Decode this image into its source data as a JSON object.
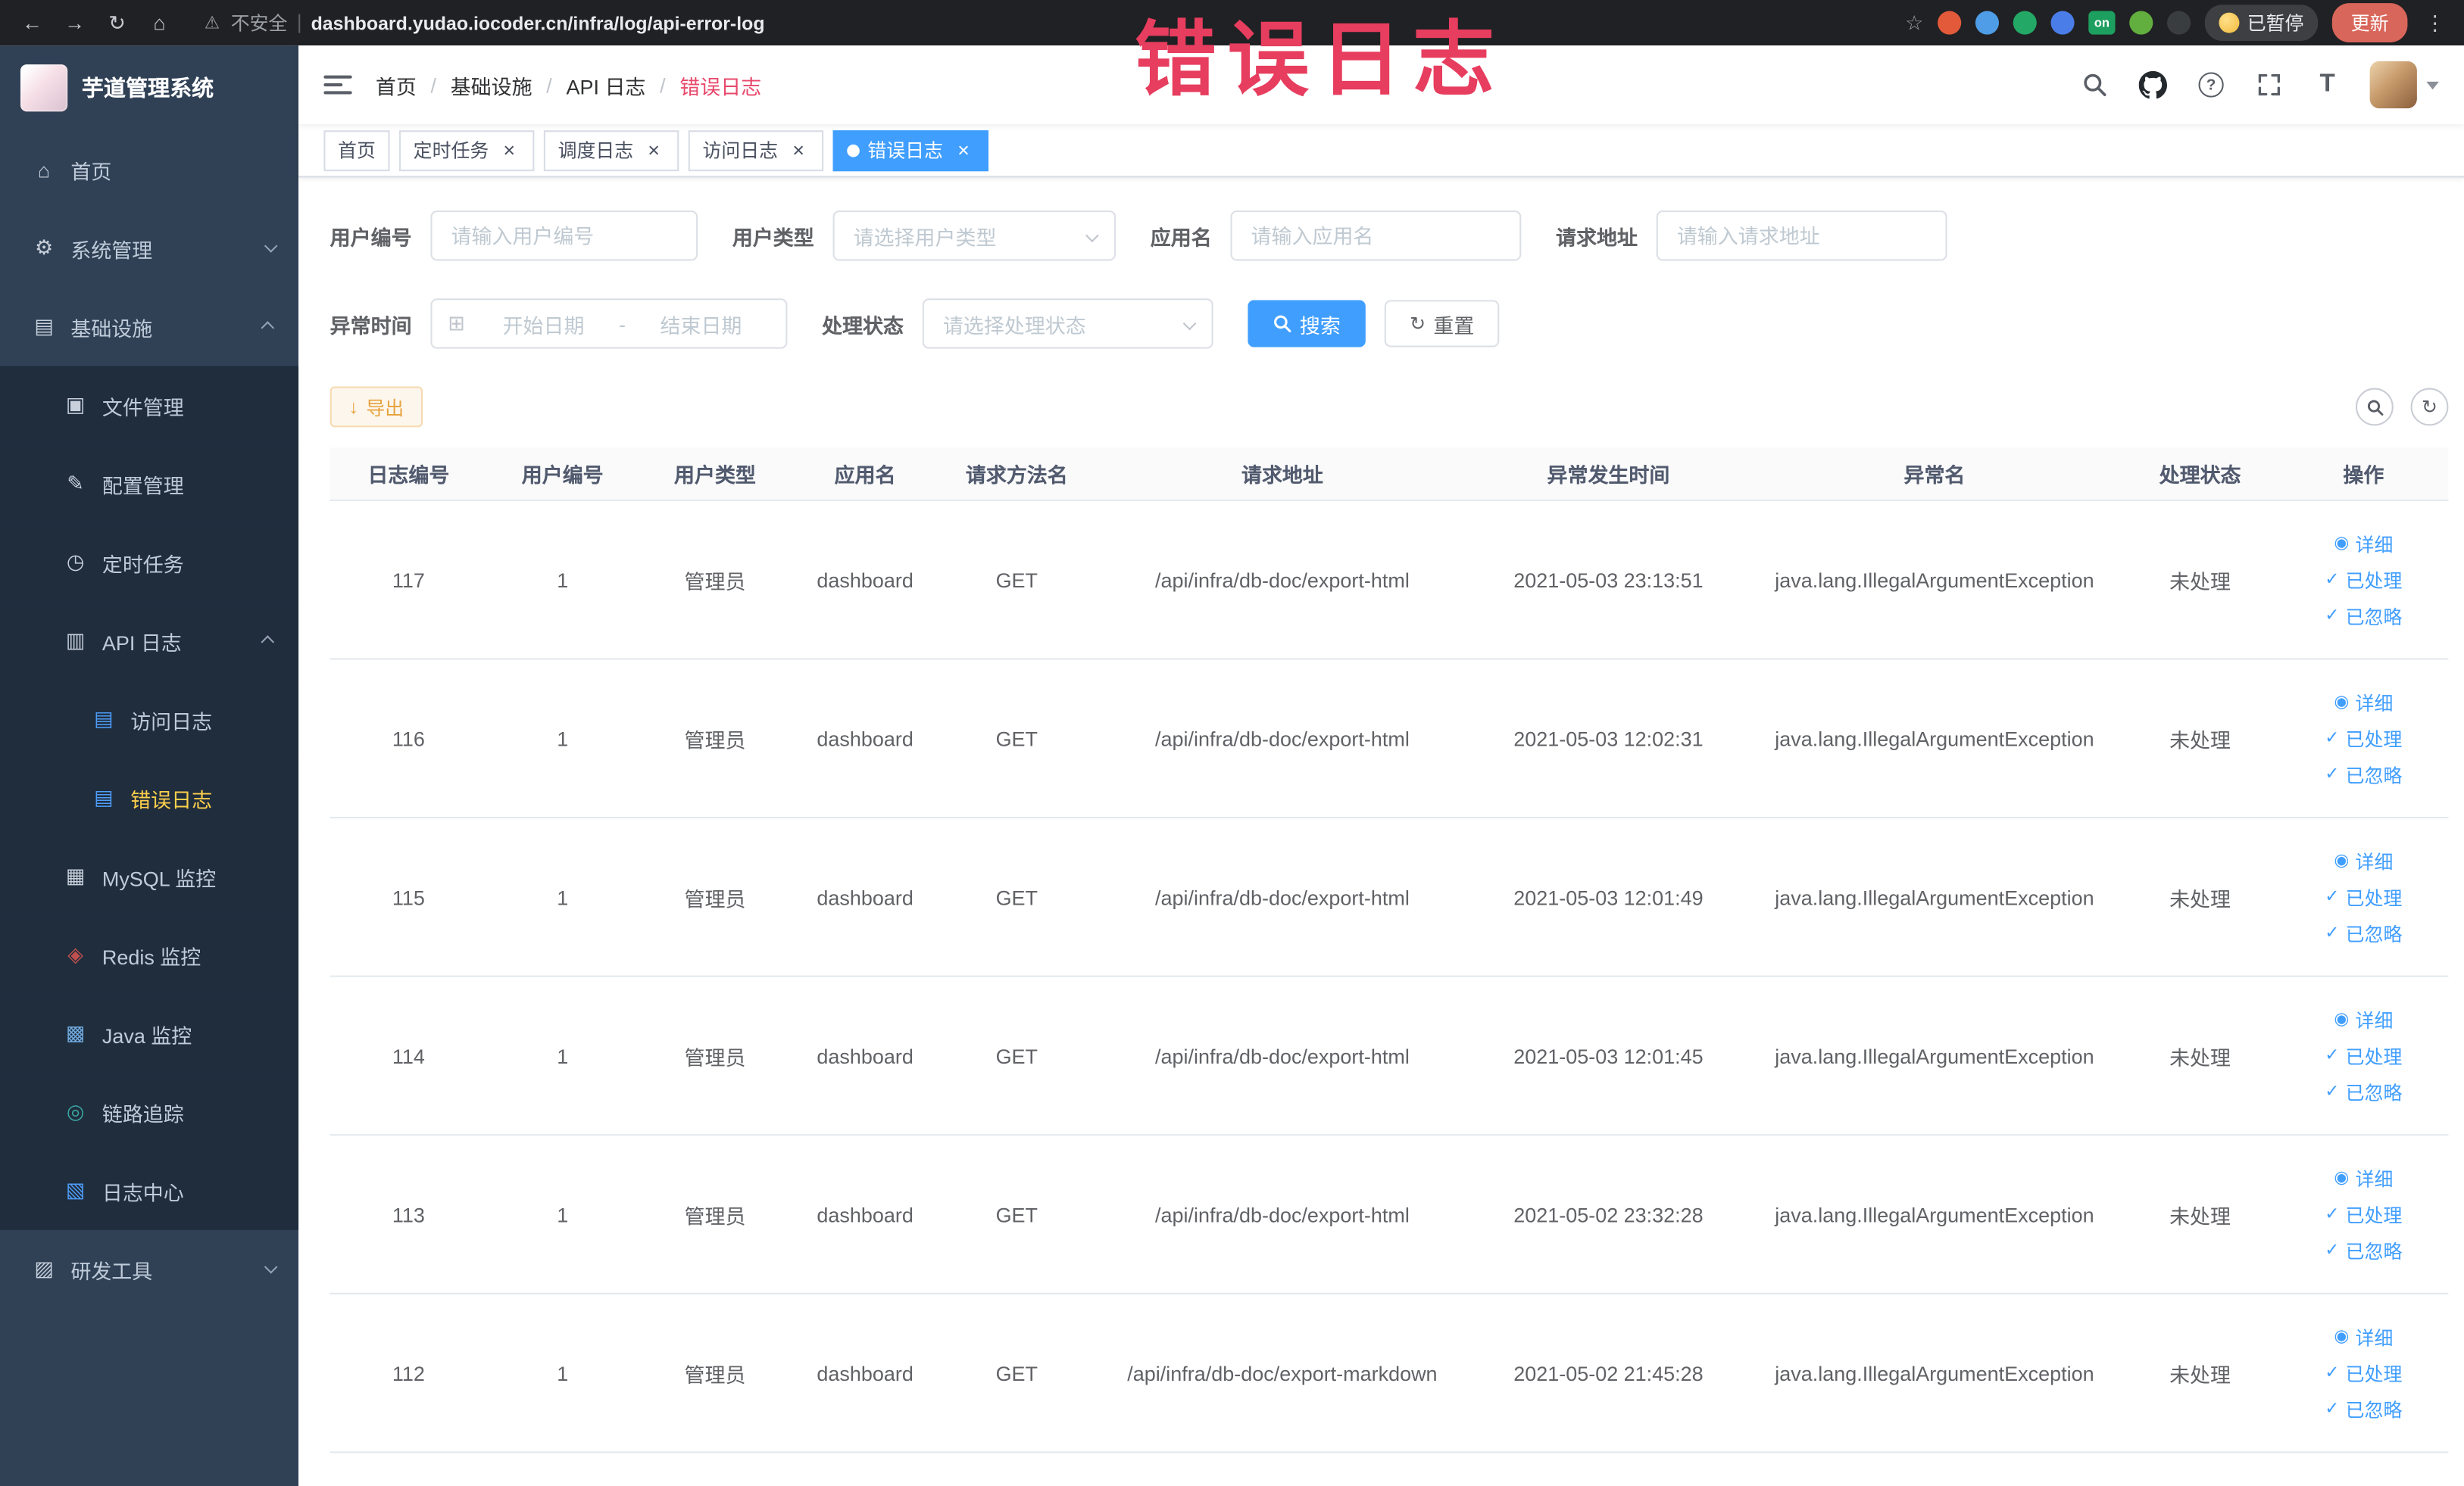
{
  "colors": {
    "accent": "#409EFF",
    "annotation": "#e73d5e",
    "sidebar_bg": "#304156",
    "submenu_bg": "#1f2d3d",
    "menu_active_text": "#ffd04b",
    "warning_text": "#e6a23c",
    "warning_bg": "#fdf6ec",
    "warning_border": "#f5dab1"
  },
  "annotation": {
    "text": "错误日志"
  },
  "icons": {
    "back-icon": "←",
    "forward-icon": "→",
    "reload-icon": "↻",
    "browser-home-icon": "⌂",
    "warning-icon": "⚠",
    "star-icon": "☆",
    "kebab-icon": "⋮",
    "home-icon": "⌂",
    "gear-icon": "⚙",
    "infra-icon": "▤",
    "file-icon": "▣",
    "config-icon": "✎",
    "timer-icon": "◷",
    "api-icon": "▥",
    "doc-icon": "▤",
    "db-icon": "▦",
    "redis-icon": "◈",
    "java-icon": "▩",
    "trace-icon": "◎",
    "log-center-icon": "▧",
    "tools-icon": "▨",
    "calendar-icon": "⊞",
    "close-icon": "×",
    "eye-icon": "◉",
    "check-icon": "✓",
    "download-icon": "↓",
    "refresh-icon": "↻",
    "question-icon": "?",
    "font-size-icon": "T"
  },
  "browser": {
    "security_label": "不安全",
    "url": "dashboard.yudao.iocoder.cn/infra/log/api-error-log",
    "paused_badge": "已暂停",
    "update_button": "更新",
    "extensions": [
      {
        "name": "ext-circle-red-icon",
        "color": "#e25a3a",
        "label": ""
      },
      {
        "name": "ext-drop-blue-icon",
        "color": "#4e9de6",
        "label": ""
      },
      {
        "name": "ext-circle-green-icon",
        "color": "#23a866",
        "label": ""
      },
      {
        "name": "ext-grid-blue-icon",
        "color": "#4a7de8",
        "label": ""
      },
      {
        "name": "ext-on-badge-icon",
        "color": "#1d9f5f",
        "label": "on"
      },
      {
        "name": "ext-leaf-green-icon",
        "color": "#62ae3e",
        "label": ""
      },
      {
        "name": "ext-paw-dark-icon",
        "color": "#3a3d40",
        "label": ""
      }
    ]
  },
  "sidebar": {
    "logo_title": "芋道管理系统",
    "items": [
      {
        "key": "home",
        "label": "首页",
        "icon": "home-icon",
        "depth": 0
      },
      {
        "key": "system-mgmt",
        "label": "系统管理",
        "icon": "gear-icon",
        "depth": 0,
        "arrow": "down"
      },
      {
        "key": "infrastructure",
        "label": "基础设施",
        "icon": "infra-icon",
        "depth": 0,
        "arrow": "up"
      },
      {
        "key": "file-mgmt",
        "label": "文件管理",
        "icon": "file-icon",
        "depth": 1
      },
      {
        "key": "config-mgmt",
        "label": "配置管理",
        "icon": "config-icon",
        "depth": 1
      },
      {
        "key": "cron-job",
        "label": "定时任务",
        "icon": "timer-icon",
        "depth": 1
      },
      {
        "key": "api-log",
        "label": "API 日志",
        "icon": "api-icon",
        "depth": 1,
        "arrow": "up"
      },
      {
        "key": "access-log",
        "label": "访问日志",
        "icon": "doc-icon",
        "depth": 2,
        "icon_color": "#4f9efc"
      },
      {
        "key": "error-log",
        "label": "错误日志",
        "icon": "doc-icon",
        "depth": 2,
        "active": true,
        "icon_color": "#4f9efc"
      },
      {
        "key": "mysql-monitor",
        "label": "MySQL 监控",
        "icon": "db-icon",
        "depth": 1
      },
      {
        "key": "redis-monitor",
        "label": "Redis 监控",
        "icon": "redis-icon",
        "depth": 1,
        "icon_color": "#c0504d"
      },
      {
        "key": "java-monitor",
        "label": "Java 监控",
        "icon": "java-icon",
        "depth": 1,
        "icon_color": "#6fa8dc"
      },
      {
        "key": "trace",
        "label": "链路追踪",
        "icon": "trace-icon",
        "depth": 1,
        "icon_color": "#3aa6a0"
      },
      {
        "key": "log-center",
        "label": "日志中心",
        "icon": "log-center-icon",
        "depth": 1,
        "icon_color": "#4f9efc"
      },
      {
        "key": "dev-tools",
        "label": "研发工具",
        "icon": "tools-icon",
        "depth": 0,
        "arrow": "down"
      }
    ]
  },
  "navbar": {
    "breadcrumb": [
      "首页",
      "基础设施",
      "API 日志",
      "错误日志"
    ],
    "separator": "/"
  },
  "tabs": [
    {
      "label": "首页",
      "closable": false,
      "active": false
    },
    {
      "label": "定时任务",
      "closable": true,
      "active": false
    },
    {
      "label": "调度日志",
      "closable": true,
      "active": false
    },
    {
      "label": "访问日志",
      "closable": true,
      "active": false
    },
    {
      "label": "错误日志",
      "closable": true,
      "active": true
    }
  ],
  "filters": {
    "user_id": {
      "label": "用户编号",
      "placeholder": "请输入用户编号"
    },
    "user_type": {
      "label": "用户类型",
      "placeholder": "请选择用户类型"
    },
    "app_name": {
      "label": "应用名",
      "placeholder": "请输入应用名"
    },
    "request_url": {
      "label": "请求地址",
      "placeholder": "请输入请求地址"
    },
    "exception_time": {
      "label": "异常时间",
      "start_placeholder": "开始日期",
      "separator": "-",
      "end_placeholder": "结束日期"
    },
    "process_status": {
      "label": "处理状态",
      "placeholder": "请选择处理状态"
    },
    "search_label": "搜索",
    "reset_label": "重置"
  },
  "toolbar": {
    "export_label": "导出"
  },
  "table": {
    "columns": [
      "日志编号",
      "用户编号",
      "用户类型",
      "应用名",
      "请求方法名",
      "请求地址",
      "异常发生时间",
      "异常名",
      "处理状态",
      "操作"
    ],
    "actions": {
      "detail": "详细",
      "process": "已处理",
      "ignore": "已忽略"
    },
    "rows": [
      {
        "log_id": "117",
        "user_id": "1",
        "user_type": "管理员",
        "app_name": "dashboard",
        "method": "GET",
        "url": "/api/infra/db-doc/export-html",
        "time": "2021-05-03 23:13:51",
        "exception": "java.lang.IllegalArgumentException",
        "status": "未处理"
      },
      {
        "log_id": "116",
        "user_id": "1",
        "user_type": "管理员",
        "app_name": "dashboard",
        "method": "GET",
        "url": "/api/infra/db-doc/export-html",
        "time": "2021-05-03 12:02:31",
        "exception": "java.lang.IllegalArgumentException",
        "status": "未处理"
      },
      {
        "log_id": "115",
        "user_id": "1",
        "user_type": "管理员",
        "app_name": "dashboard",
        "method": "GET",
        "url": "/api/infra/db-doc/export-html",
        "time": "2021-05-03 12:01:49",
        "exception": "java.lang.IllegalArgumentException",
        "status": "未处理"
      },
      {
        "log_id": "114",
        "user_id": "1",
        "user_type": "管理员",
        "app_name": "dashboard",
        "method": "GET",
        "url": "/api/infra/db-doc/export-html",
        "time": "2021-05-03 12:01:45",
        "exception": "java.lang.IllegalArgumentException",
        "status": "未处理"
      },
      {
        "log_id": "113",
        "user_id": "1",
        "user_type": "管理员",
        "app_name": "dashboard",
        "method": "GET",
        "url": "/api/infra/db-doc/export-html",
        "time": "2021-05-02 23:32:28",
        "exception": "java.lang.IllegalArgumentException",
        "status": "未处理"
      },
      {
        "log_id": "112",
        "user_id": "1",
        "user_type": "管理员",
        "app_name": "dashboard",
        "method": "GET",
        "url": "/api/infra/db-doc/export-markdown",
        "time": "2021-05-02 21:45:28",
        "exception": "java.lang.IllegalArgumentException",
        "status": "未处理"
      }
    ]
  }
}
